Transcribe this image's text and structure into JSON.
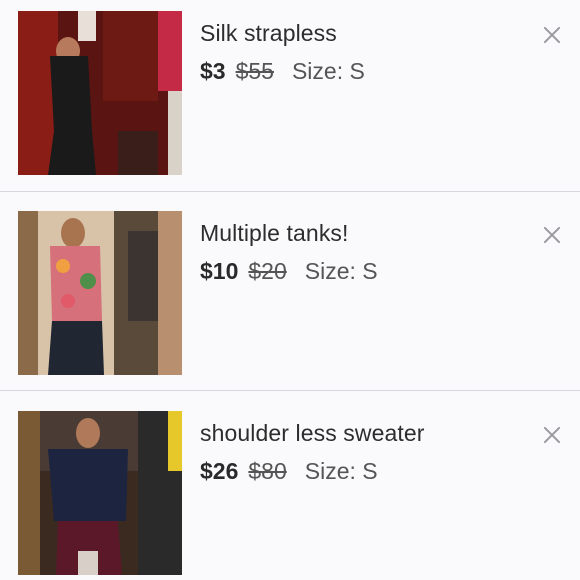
{
  "listings": [
    {
      "title": "Silk strapless",
      "price": "$3",
      "original_price": "$55",
      "size": "Size: S",
      "close_icon": "close-icon"
    },
    {
      "title": "Multiple tanks!",
      "price": "$10",
      "original_price": "$20",
      "size": "Size: S",
      "close_icon": "close-icon"
    },
    {
      "title": "shoulder less sweater",
      "price": "$26",
      "original_price": "$80",
      "size": "Size: S",
      "close_icon": "close-icon"
    }
  ],
  "colors": {
    "background": "#faf9fb",
    "divider": "#d9d8dc",
    "text": "#2d2d2d",
    "muted": "#555555",
    "close_icon": "#9b9a9f"
  }
}
